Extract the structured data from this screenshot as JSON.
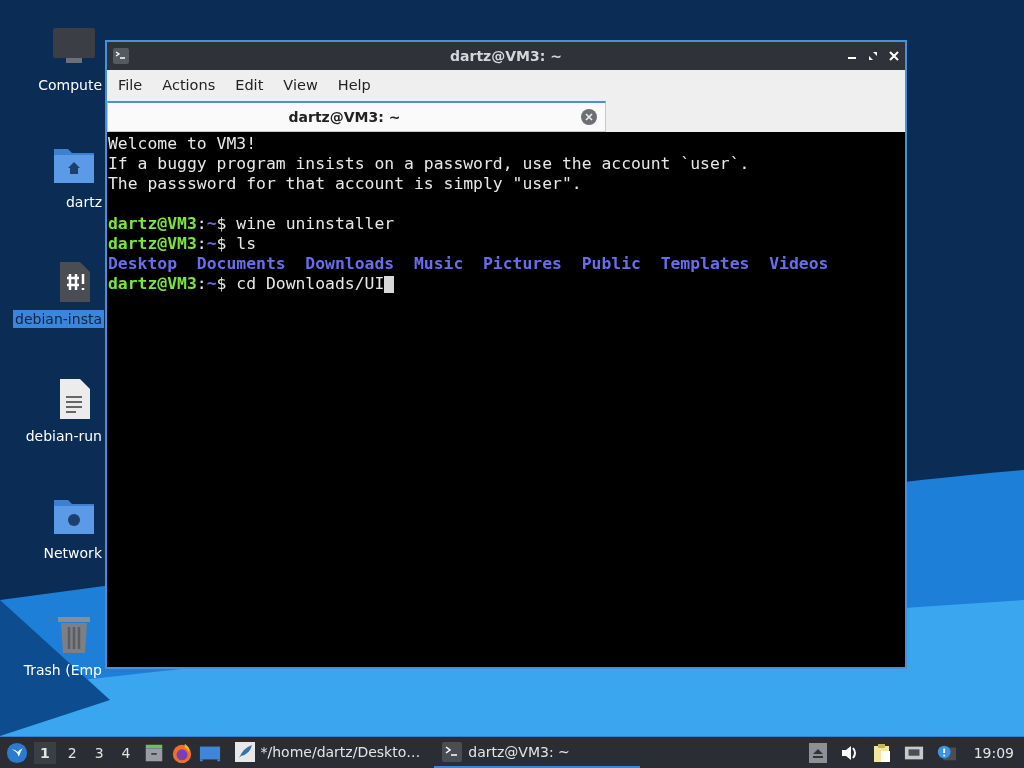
{
  "desktop_icons": [
    {
      "kind": "computer",
      "label": "Compute",
      "selected": false
    },
    {
      "kind": "home",
      "label": "dartz",
      "selected": false
    },
    {
      "kind": "script",
      "label": "debian-insta",
      "selected": true
    },
    {
      "kind": "text",
      "label": "debian-run",
      "selected": false
    },
    {
      "kind": "network",
      "label": "Network",
      "selected": false
    },
    {
      "kind": "trash",
      "label": "Trash (Emp",
      "selected": false
    }
  ],
  "window": {
    "title": "dartz@VM3: ~",
    "menu": [
      "File",
      "Actions",
      "Edit",
      "View",
      "Help"
    ],
    "tabs": [
      {
        "label": "dartz@VM3: ~",
        "selected": true
      }
    ],
    "terminal": [
      {
        "kind": "output",
        "text": "Welcome to VM3!"
      },
      {
        "kind": "output",
        "text": "If a buggy program insists on a password, use the account `user`."
      },
      {
        "kind": "output",
        "text": "The passsword for that account is simply \"user\"."
      },
      {
        "kind": "blank"
      },
      {
        "kind": "prompt",
        "host": "dartz@VM3",
        "sep": ":",
        "cwd": "~",
        "command": "$ wine uninstaller",
        "cursor": false
      },
      {
        "kind": "prompt",
        "host": "dartz@VM3",
        "sep": ":",
        "cwd": "~",
        "command": "$ ls",
        "cursor": false
      },
      {
        "kind": "listing",
        "items": [
          "Desktop",
          "Documents",
          "Downloads",
          "Music",
          "Pictures",
          "Public",
          "Templates",
          "Videos"
        ]
      },
      {
        "kind": "prompt",
        "host": "dartz@VM3",
        "sep": ":",
        "cwd": "~",
        "command": "$ cd Downloads/UI",
        "cursor": true
      }
    ]
  },
  "taskbar": {
    "workspaces": [
      {
        "label": "1",
        "selected": true
      },
      {
        "label": "2",
        "selected": false
      },
      {
        "label": "3",
        "selected": false
      },
      {
        "label": "4",
        "selected": false
      }
    ],
    "tasks": [
      {
        "kind": "editor",
        "label": "*/home/dartz/Deskto…",
        "selected": false
      },
      {
        "kind": "terminal",
        "label": "dartz@VM3: ~",
        "selected": true
      }
    ],
    "clock": "19:09"
  }
}
